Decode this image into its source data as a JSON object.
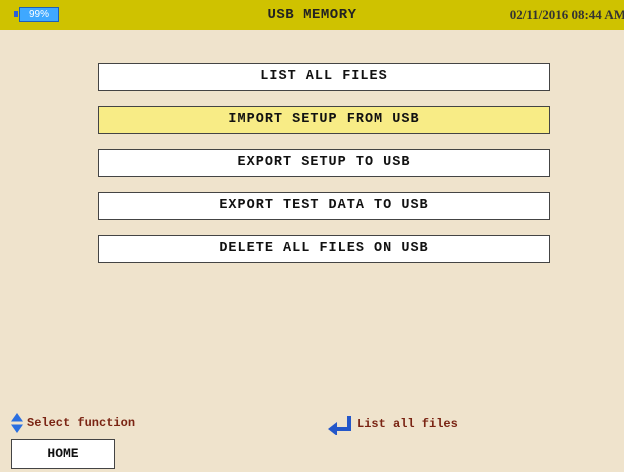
{
  "status_bar": {
    "battery_level": "99%",
    "title": "USB MEMORY",
    "datetime": "02/11/2016 08:44 AM",
    "color": "#cfc200"
  },
  "menu": {
    "items": [
      {
        "label": "LIST ALL FILES",
        "selected": false
      },
      {
        "label": "IMPORT SETUP FROM USB",
        "selected": true
      },
      {
        "label": "EXPORT SETUP TO USB",
        "selected": false
      },
      {
        "label": "EXPORT TEST DATA TO USB",
        "selected": false
      },
      {
        "label": "DELETE ALL FILES ON USB",
        "selected": false
      }
    ],
    "selected_color": "#f8ec86"
  },
  "footer": {
    "hint_select": {
      "icon": "up-down-arrows-icon",
      "text": "Select function"
    },
    "hint_enter": {
      "icon": "enter-arrow-icon",
      "text": "List all files"
    },
    "home_label": "HOME"
  }
}
